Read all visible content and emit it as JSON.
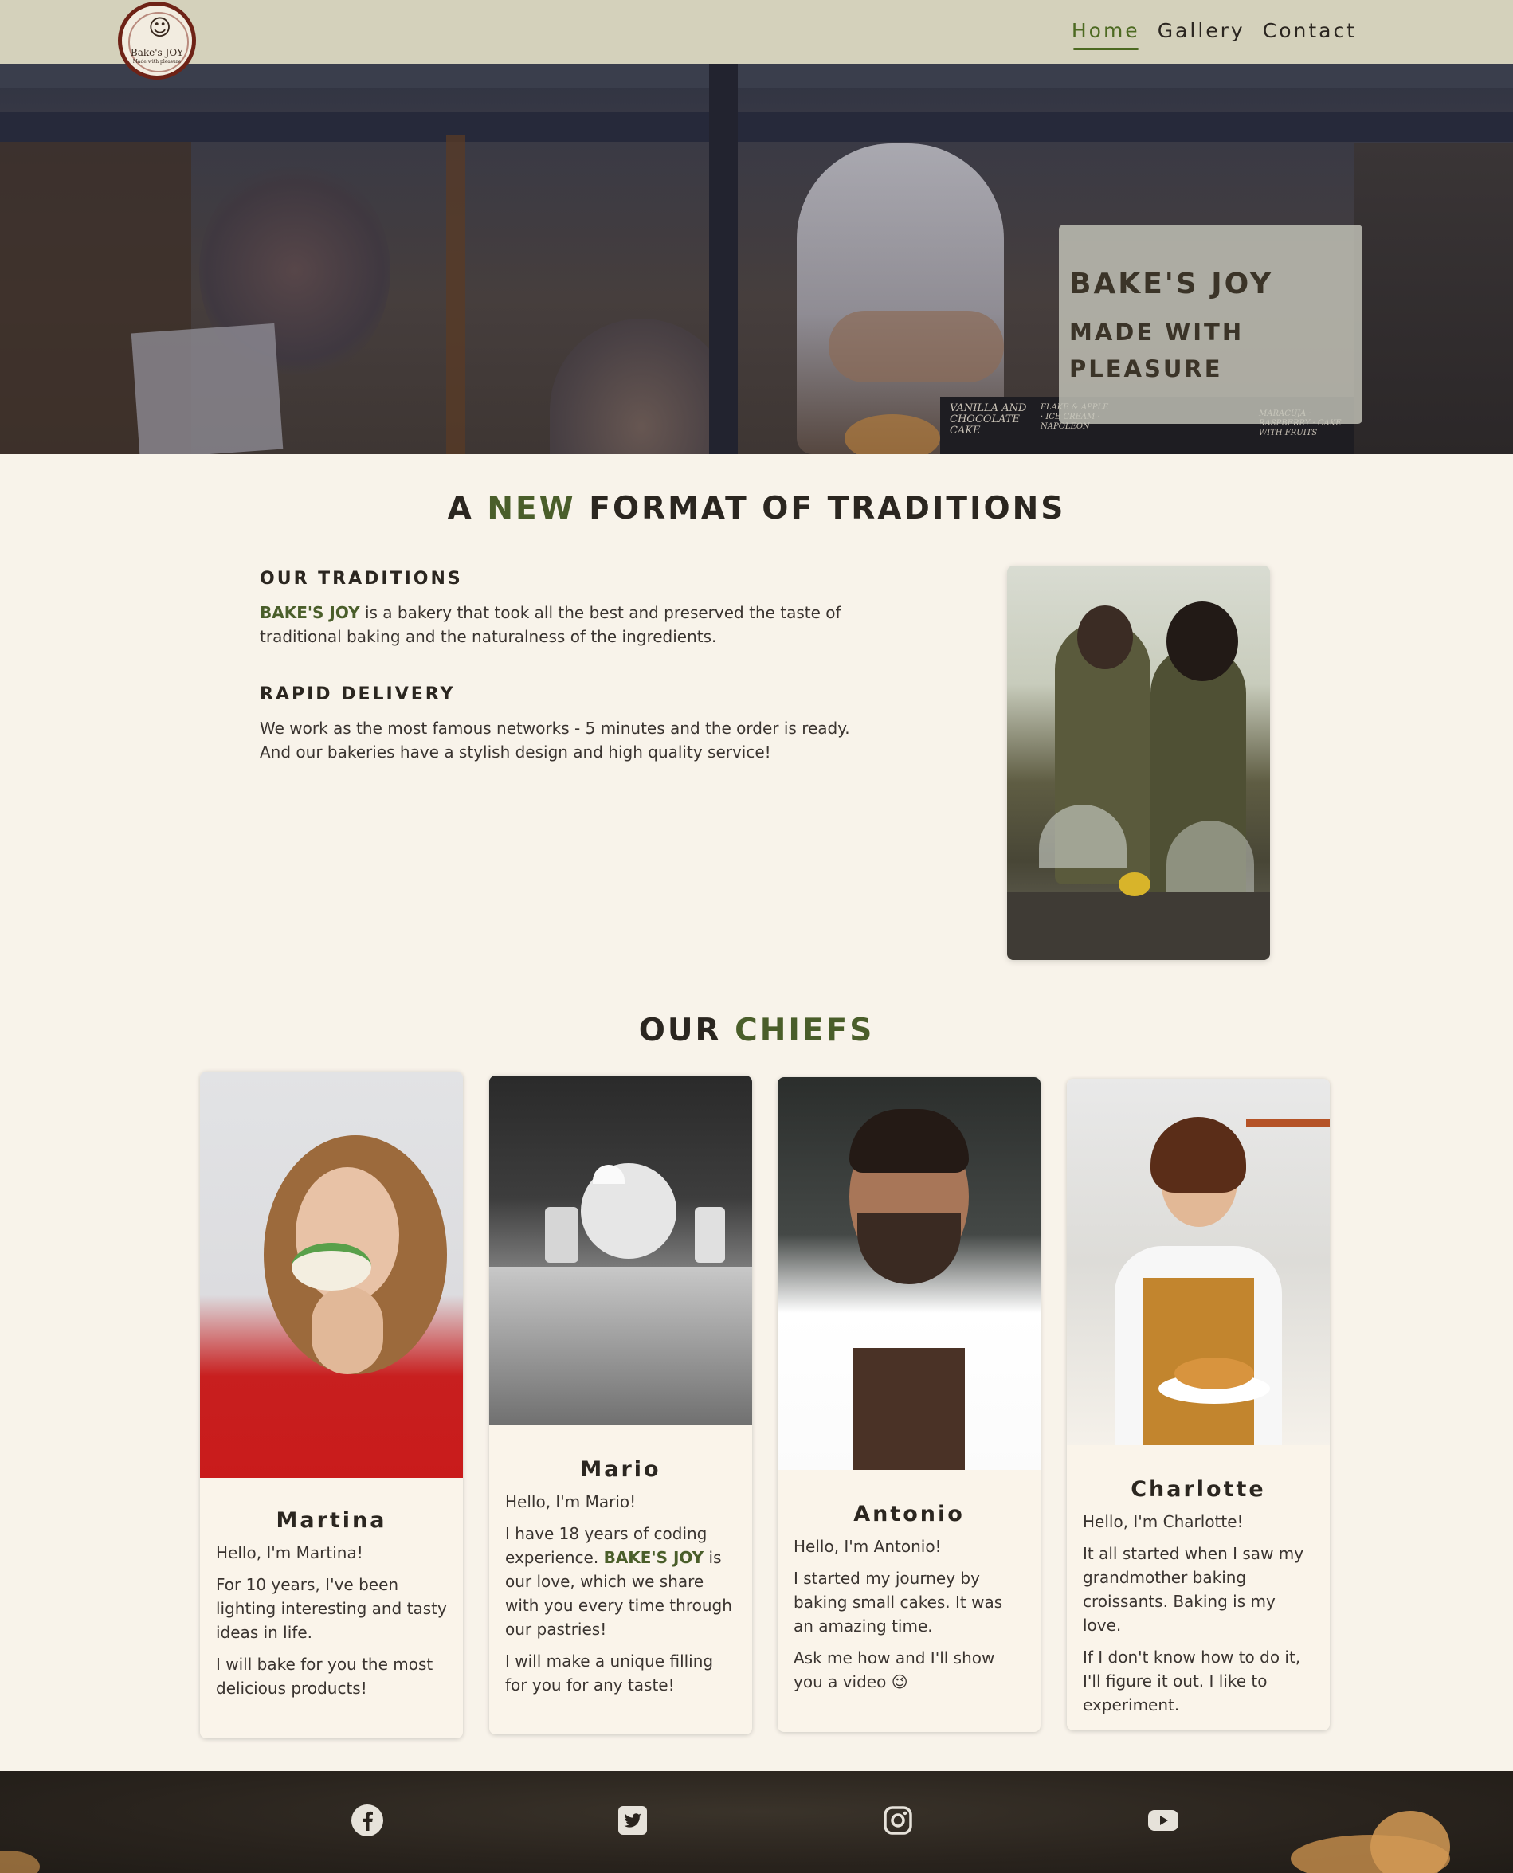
{
  "header": {
    "logo": {
      "face": "☺",
      "name": "Bake's JOY",
      "tagline": "Made with pleasure"
    },
    "nav": [
      {
        "label": "Home",
        "active": true
      },
      {
        "label": "Gallery",
        "active": false
      },
      {
        "label": "Contact",
        "active": false
      }
    ]
  },
  "hero": {
    "title": "BAKE'S JOY",
    "subtitle": "MADE WITH PLEASURE",
    "board_1": "VANILLA AND CHOCOLATE CAKE",
    "board_2": "FLAKE & APPLE · ICE CREAM · NAPOLEON",
    "board_3": "MARACUJA · RASPBERRY · CAKE WITH FRUITS"
  },
  "traditions": {
    "title_pre": "A",
    "title_accent": "NEW",
    "title_post": "FORMAT OF TRADITIONS",
    "blocks": [
      {
        "heading": "OUR TRADITIONS",
        "brand": "BAKE'S JOY",
        "text": " is a bakery that took all the best and preserved the taste of traditional baking and the naturalness of the ingredients."
      },
      {
        "heading": "RAPID DELIVERY",
        "text": "We work as the most famous networks - 5 minutes and the order is ready. And our bakeries have a stylish design and high quality service!"
      }
    ]
  },
  "chiefs": {
    "title_pre": "OUR",
    "title_accent": "CHIEFS",
    "cards": [
      {
        "name": "Martina",
        "p1": "Hello, I'm Martina!",
        "p2": "For 10 years, I've been lighting interesting and tasty ideas in life.",
        "p3": "I will bake for you the most delicious products!"
      },
      {
        "name": "Mario",
        "p1": "Hello, I'm Mario!",
        "p2_a": "I have 18 years of coding experience. ",
        "p2_brand": "BAKE'S JOY",
        "p2_b": " is our love, which we share with you every time through our pastries!",
        "p3": "I will make a unique filling for you for any taste!"
      },
      {
        "name": "Antonio",
        "p1": "Hello, I'm Antonio!",
        "p2": "I started my journey by baking small cakes. It was an amazing time.",
        "p3": "Ask me how and I'll show you a video 😉"
      },
      {
        "name": "Charlotte",
        "p1": "Hello, I'm Charlotte!",
        "p2": "It all started when I saw my grandmother baking croissants. Baking is my love.",
        "p3": "If I don't know how to do it, I'll figure it out. I like to experiment."
      }
    ]
  },
  "footer": {
    "social": [
      {
        "icon": "facebook-icon"
      },
      {
        "icon": "twitter-icon"
      },
      {
        "icon": "instagram-icon"
      },
      {
        "icon": "youtube-icon"
      }
    ]
  }
}
